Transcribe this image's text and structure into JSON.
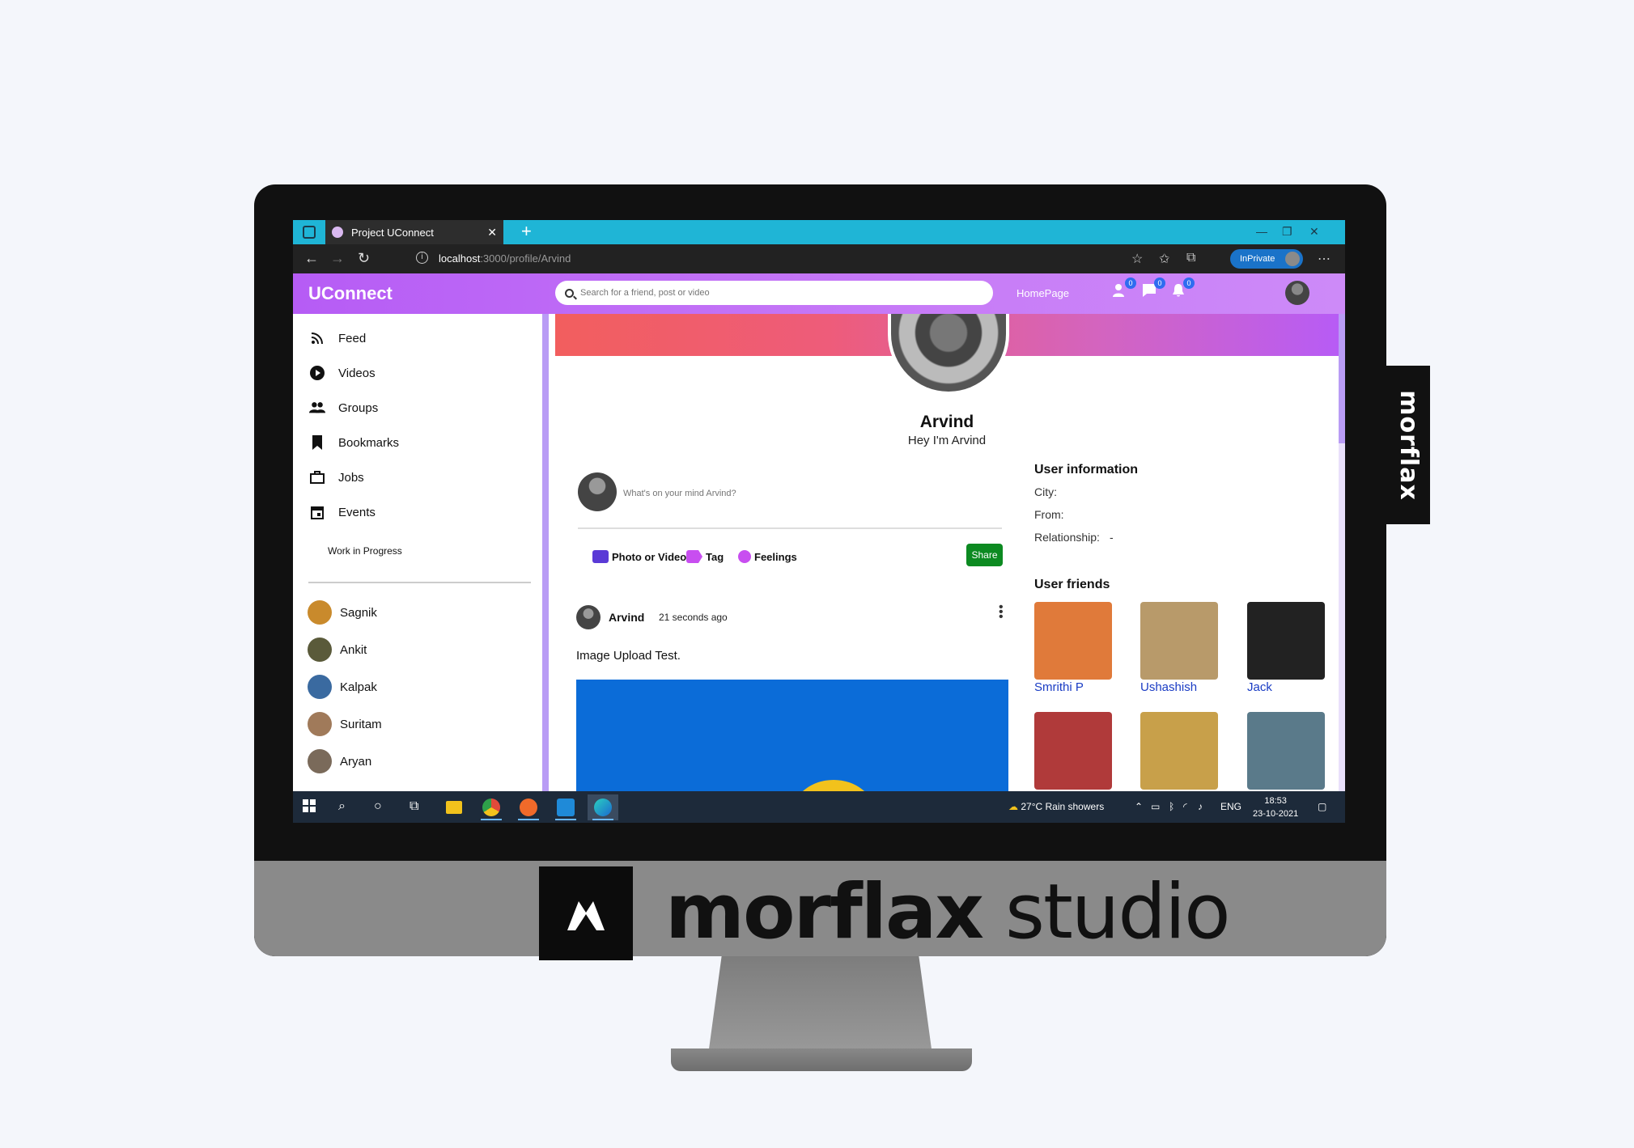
{
  "browser": {
    "tab_title": "Project UConnect",
    "url_host": "localhost",
    "url_path": ":3000/profile/Arvind",
    "inprivate_label": "InPrivate"
  },
  "app": {
    "logo": "UConnect",
    "search_placeholder": "Search for a friend, post or video",
    "homepage_link": "HomePage",
    "badges": {
      "friends": "0",
      "messages": "0",
      "notifications": "0"
    }
  },
  "sidebar": {
    "items": [
      {
        "label": "Feed",
        "icon": "rss-icon"
      },
      {
        "label": "Videos",
        "icon": "play-circle-icon"
      },
      {
        "label": "Groups",
        "icon": "group-icon"
      },
      {
        "label": "Bookmarks",
        "icon": "bookmark-icon"
      },
      {
        "label": "Jobs",
        "icon": "briefcase-icon"
      },
      {
        "label": "Events",
        "icon": "calendar-icon"
      }
    ],
    "wip_label": "Work in Progress",
    "friends": [
      {
        "name": "Sagnik",
        "color": "#c98a2c"
      },
      {
        "name": "Ankit",
        "color": "#5a5a3a"
      },
      {
        "name": "Kalpak",
        "color": "#3a6aa0"
      },
      {
        "name": "Suritam",
        "color": "#a07a5a"
      },
      {
        "name": "Aryan",
        "color": "#7a6a5a"
      }
    ]
  },
  "profile": {
    "name": "Arvind",
    "bio": "Hey I'm Arvind"
  },
  "share": {
    "placeholder": "What's on your mind Arvind?",
    "photo_label": "Photo or Video",
    "tag_label": "Tag",
    "feelings_label": "Feelings",
    "share_button": "Share",
    "colors": {
      "photo": "#5a3ad6",
      "tag": "#c84ef0",
      "feelings": "#c84ef0"
    }
  },
  "post": {
    "author": "Arvind",
    "time": "21 seconds ago",
    "text": "Image Upload Test."
  },
  "user_info": {
    "title": "User information",
    "city_label": "City:",
    "city_value": "",
    "from_label": "From:",
    "from_value": "",
    "relationship_label": "Relationship:",
    "relationship_value": "-"
  },
  "user_friends": {
    "title": "User friends",
    "items": [
      {
        "name": "Smrithi P",
        "color": "#e07a3a"
      },
      {
        "name": "Ushashish",
        "color": "#b89a6a"
      },
      {
        "name": "Jack",
        "color": "#222222"
      },
      {
        "name": "",
        "color": "#b03a3a"
      },
      {
        "name": "",
        "color": "#c8a04a"
      },
      {
        "name": "",
        "color": "#5a7a8a"
      }
    ]
  },
  "taskbar": {
    "weather": "27°C  Rain showers",
    "lang": "ENG",
    "time": "18:53",
    "date": "23-10-2021"
  },
  "brand": {
    "side_tab": "morflax",
    "word_bold": "morflax",
    "word_light": "studio"
  }
}
